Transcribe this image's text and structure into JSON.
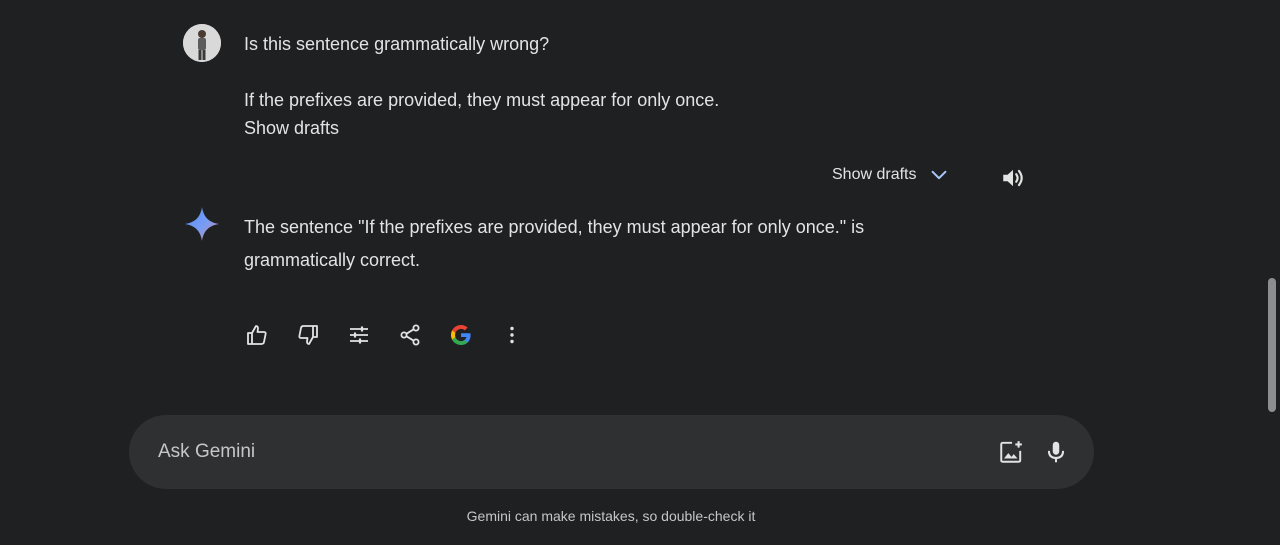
{
  "conversation": {
    "user_message": {
      "lines": [
        "Is this sentence grammatically wrong?",
        "If the prefixes are provided, they must appear for only once.",
        "Show drafts"
      ]
    },
    "show_drafts_label": "Show drafts",
    "response": {
      "text": "The sentence \"If the prefixes are provided, they must appear for only once.\" is grammatically correct."
    },
    "actions": [
      {
        "icon": "thumb-up-icon"
      },
      {
        "icon": "thumb-down-icon"
      },
      {
        "icon": "tune-icon"
      },
      {
        "icon": "share-icon"
      },
      {
        "icon": "google-icon"
      },
      {
        "icon": "more-vert-icon"
      }
    ]
  },
  "input": {
    "placeholder": "Ask Gemini",
    "value": ""
  },
  "footer": {
    "disclaimer": "Gemini can make mistakes, so double-check it"
  },
  "colors": {
    "background": "#1f2021",
    "input_background": "#2f3031",
    "text": "#e3e3e3",
    "accent_blue": "#a8c7fa"
  }
}
